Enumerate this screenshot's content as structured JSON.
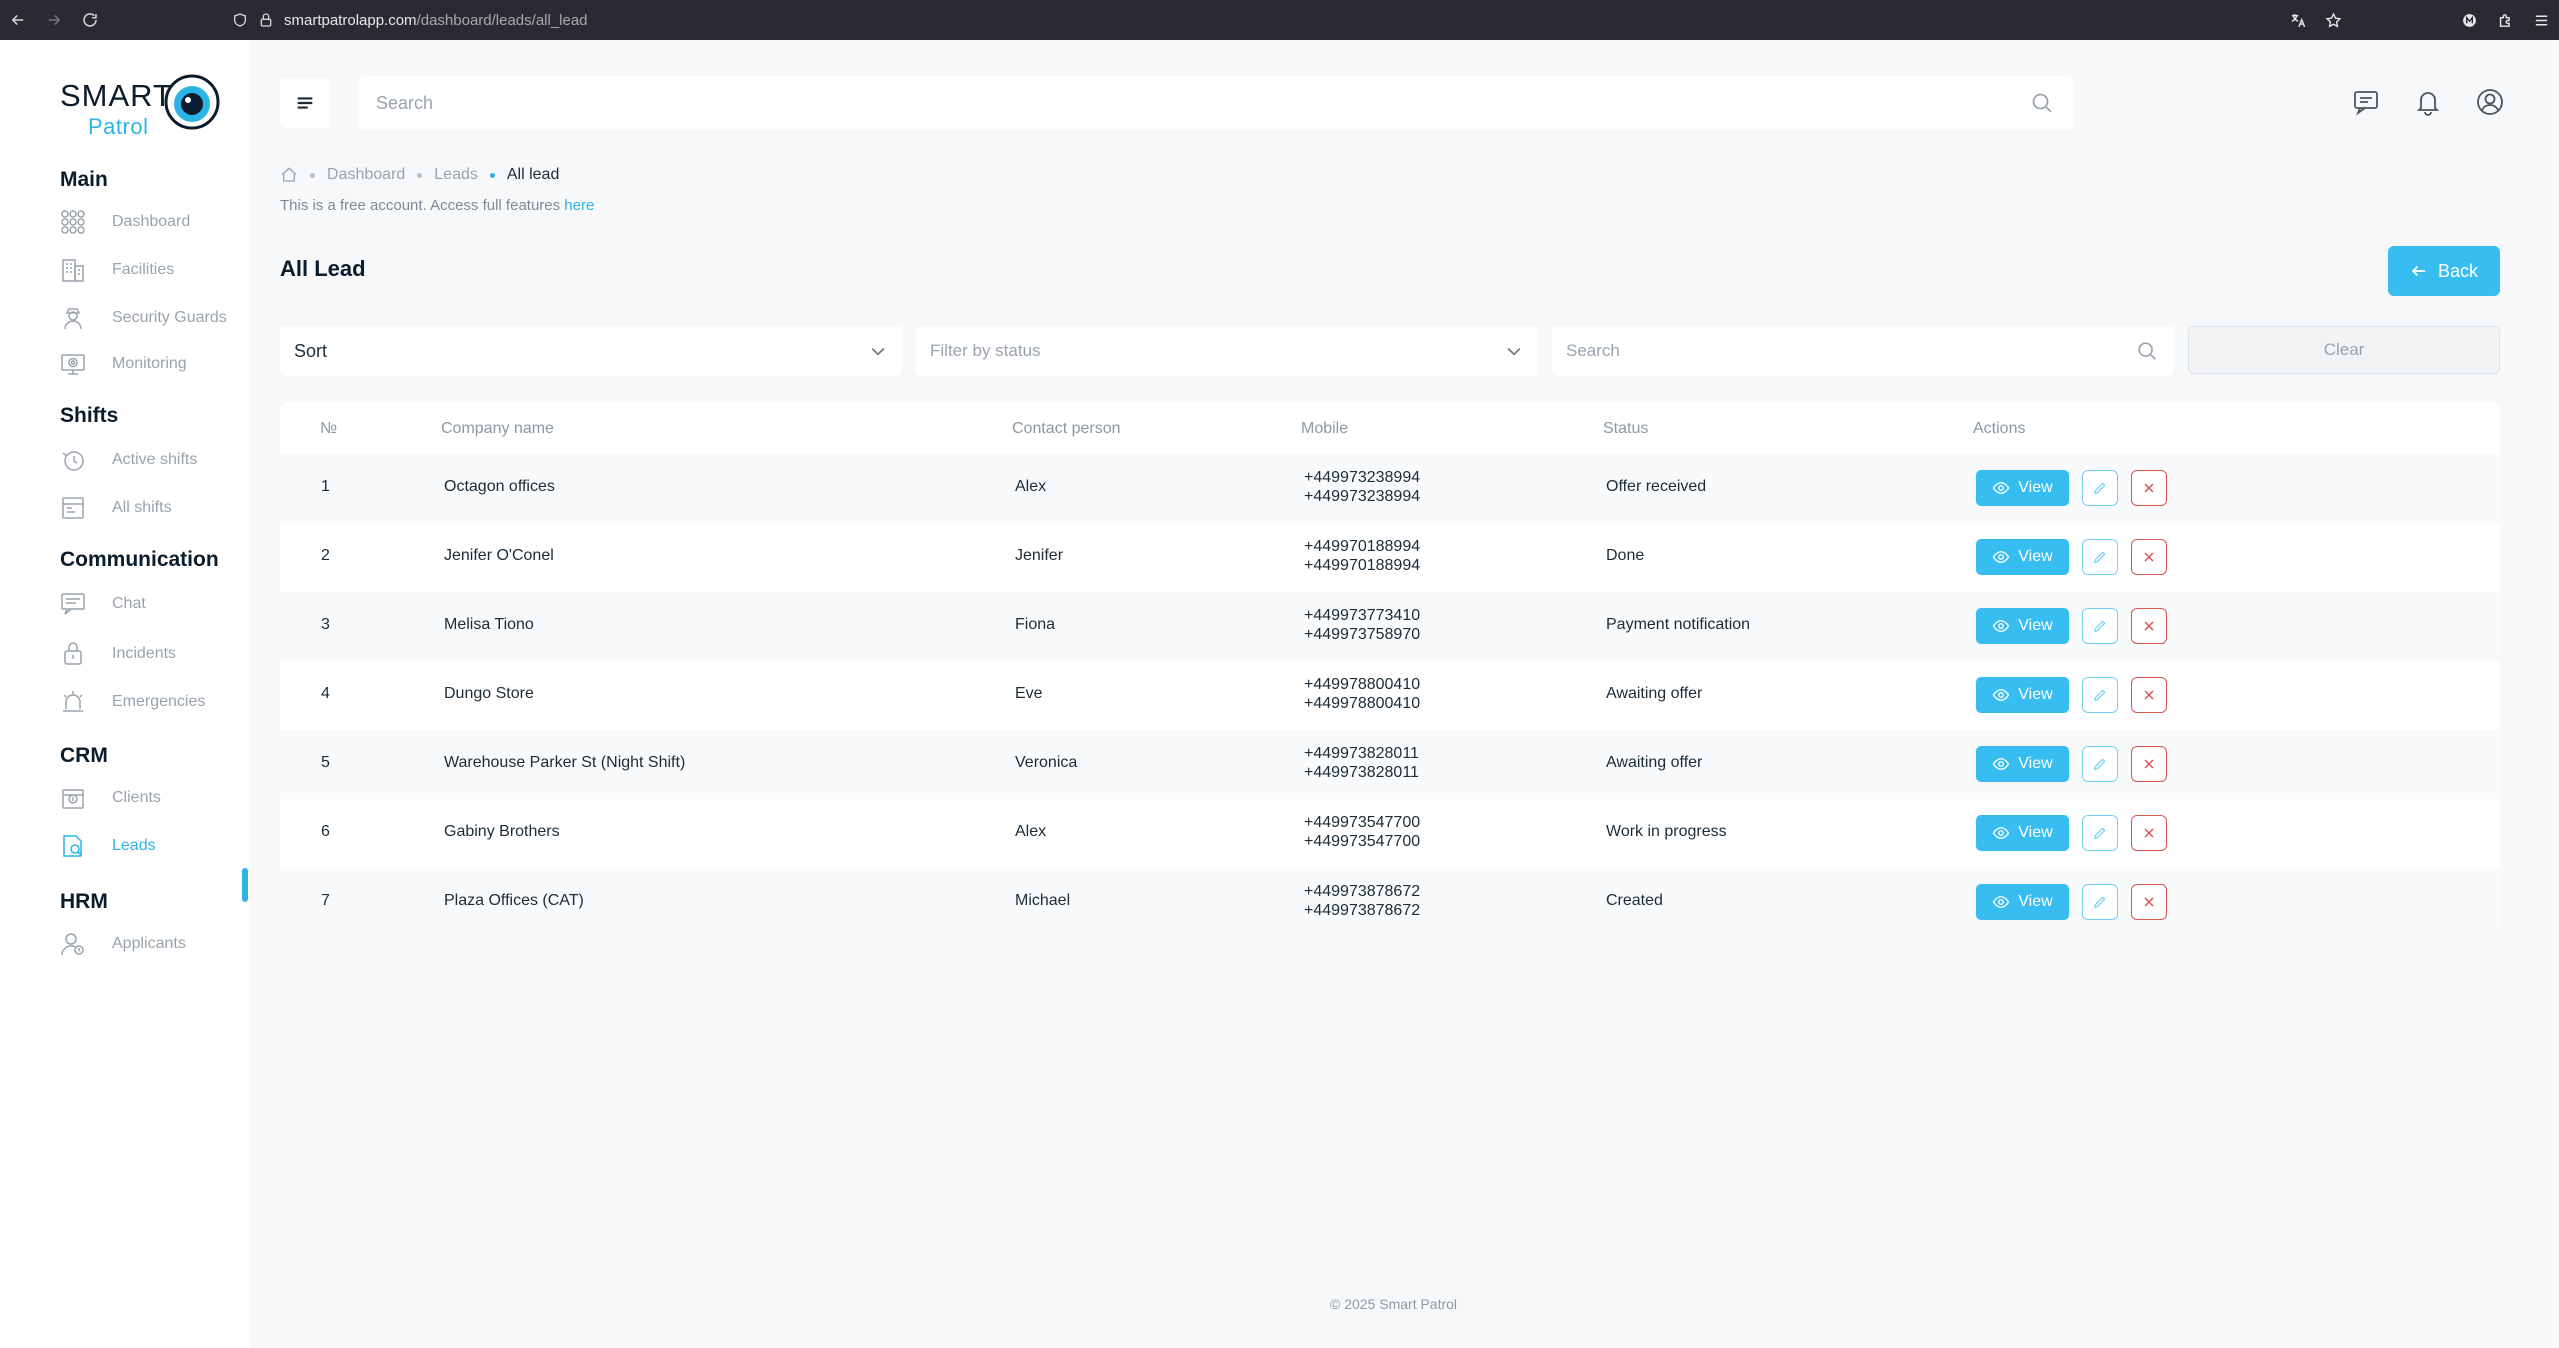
{
  "browser": {
    "url_host": "smartpatrolapp.com",
    "url_path": "/dashboard/leads/all_lead"
  },
  "logo": {
    "smart": "SMART",
    "patrol": "Patrol"
  },
  "sidebar": {
    "sections": [
      {
        "title": "Main",
        "items": [
          {
            "label": "Dashboard",
            "icon": "grid-icon"
          },
          {
            "label": "Facilities",
            "icon": "building-icon"
          },
          {
            "label": "Security Guards",
            "icon": "guard-icon"
          },
          {
            "label": "Monitoring",
            "icon": "monitor-icon"
          }
        ]
      },
      {
        "title": "Shifts",
        "items": [
          {
            "label": "Active shifts",
            "icon": "clock-hand-icon"
          },
          {
            "label": "All shifts",
            "icon": "calendar-icon"
          }
        ]
      },
      {
        "title": "Communication",
        "items": [
          {
            "label": "Chat",
            "icon": "chat-icon"
          },
          {
            "label": "Incidents",
            "icon": "incident-icon"
          },
          {
            "label": "Emergencies",
            "icon": "alarm-icon"
          }
        ]
      },
      {
        "title": "CRM",
        "items": [
          {
            "label": "Clients",
            "icon": "clients-icon"
          },
          {
            "label": "Leads",
            "icon": "leads-icon",
            "active": true
          }
        ]
      },
      {
        "title": "HRM",
        "items": [
          {
            "label": "Applicants",
            "icon": "applicant-icon"
          }
        ]
      }
    ]
  },
  "topbar": {
    "search_placeholder": "Search"
  },
  "breadcrumb": {
    "items": [
      "Dashboard",
      "Leads"
    ],
    "current": "All lead"
  },
  "notice": {
    "text": "This is a free account. Access full features ",
    "link": "here"
  },
  "page": {
    "title": "All Lead",
    "back_label": "Back"
  },
  "filters": {
    "sort_label": "Sort",
    "status_placeholder": "Filter by status",
    "search_placeholder": "Search",
    "clear_label": "Clear"
  },
  "table": {
    "headers": [
      "№",
      "Company name",
      "Contact person",
      "Mobile",
      "Status",
      "Actions"
    ],
    "view_label": "View",
    "rows": [
      {
        "no": "1",
        "company": "Octagon offices",
        "contact": "Alex",
        "mobile1": "+449973238994",
        "mobile2": "+449973238994",
        "status": "Offer received"
      },
      {
        "no": "2",
        "company": "Jenifer O'Conel",
        "contact": "Jenifer",
        "mobile1": "+449970188994",
        "mobile2": "+449970188994",
        "status": "Done"
      },
      {
        "no": "3",
        "company": "Melisa Tiono",
        "contact": "Fiona",
        "mobile1": "+449973773410",
        "mobile2": "+449973758970",
        "status": "Payment notification"
      },
      {
        "no": "4",
        "company": "Dungo Store",
        "contact": "Eve",
        "mobile1": "+449978800410",
        "mobile2": "+449978800410",
        "status": "Awaiting offer"
      },
      {
        "no": "5",
        "company": "Warehouse Parker St (Night Shift)",
        "contact": "Veronica",
        "mobile1": "+449973828011",
        "mobile2": "+449973828011",
        "status": "Awaiting offer"
      },
      {
        "no": "6",
        "company": "Gabiny Brothers",
        "contact": "Alex",
        "mobile1": "+449973547700",
        "mobile2": "+449973547700",
        "status": "Work in progress"
      },
      {
        "no": "7",
        "company": "Plaza Offices (CAT)",
        "contact": "Michael",
        "mobile1": "+449973878672",
        "mobile2": "+449973878672",
        "status": "Created"
      }
    ]
  },
  "footer": {
    "text": "© 2025 Smart Patrol"
  },
  "colors": {
    "accent": "#37bdf0",
    "danger": "#d9534f",
    "sidebar_bg": "#ffffff",
    "page_bg": "#f7f8fa"
  }
}
